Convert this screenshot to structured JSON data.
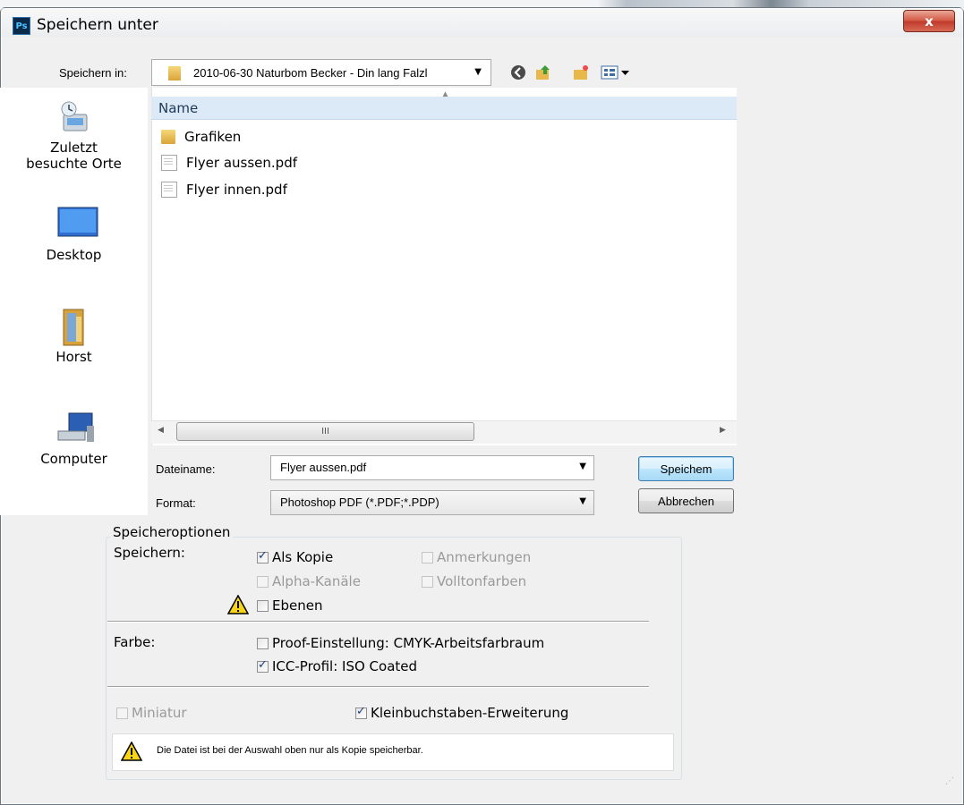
{
  "window": {
    "title": "Speichern unter",
    "app_icon_text": "Ps",
    "close_glyph": "x"
  },
  "location": {
    "label": "Speichern in:",
    "value": "2010-06-30 Naturbom Becker - Din lang Falzl"
  },
  "places": [
    {
      "label_lines": [
        "Zuletzt",
        "besuchte Orte"
      ],
      "icon": "recent-places-icon"
    },
    {
      "label_lines": [
        "Desktop"
      ],
      "icon": "desktop-icon"
    },
    {
      "label_lines": [
        "Horst"
      ],
      "icon": "user-folder-icon"
    },
    {
      "label_lines": [
        "Computer"
      ],
      "icon": "computer-icon"
    }
  ],
  "file_list": {
    "column_header": "Name",
    "items": [
      {
        "name": "Grafiken",
        "type": "folder"
      },
      {
        "name": "Flyer aussen.pdf",
        "type": "pdf"
      },
      {
        "name": "Flyer innen.pdf",
        "type": "pdf"
      }
    ],
    "scroll_thumb_glyph": "III"
  },
  "filename": {
    "label": "Dateiname:",
    "value": "Flyer aussen.pdf"
  },
  "format": {
    "label": "Format:",
    "value": "Photoshop PDF (*.PDF;*.PDP)"
  },
  "buttons": {
    "save": "Speichem",
    "cancel": "Abbrechen"
  },
  "options": {
    "group_title": "Speicheroptionen",
    "save_label": "Speichern:",
    "color_label": "Farbe:",
    "as_copy": {
      "label": "Als Kopie",
      "checked": true
    },
    "annotations": {
      "label": "Anmerkungen",
      "checked": false
    },
    "alpha_channels": {
      "label": "Alpha-Kanäle",
      "checked": false
    },
    "spot_colors": {
      "label": "Volltonfarben",
      "checked": false
    },
    "layers": {
      "label": "Ebenen",
      "checked": false
    },
    "proof_setup": {
      "label": "Proof-Einstellung: CMYK-Arbeitsfarbraum",
      "checked": false
    },
    "icc_profile": {
      "label": "ICC-Profil: ISO Coated",
      "checked": true
    },
    "thumbnail": {
      "label": "Miniatur",
      "checked": false
    },
    "lowercase_ext": {
      "label": "Kleinbuchstaben-Erweiterung",
      "checked": true
    },
    "notice": "Die Datei ist bei der Auswahl oben nur als Kopie speicherbar."
  },
  "colors": {
    "close_red": "#c0392b",
    "header_blue": "#dce9f7",
    "folder_yellow": "#e8b94a",
    "warning_yellow": "#f7d417"
  }
}
